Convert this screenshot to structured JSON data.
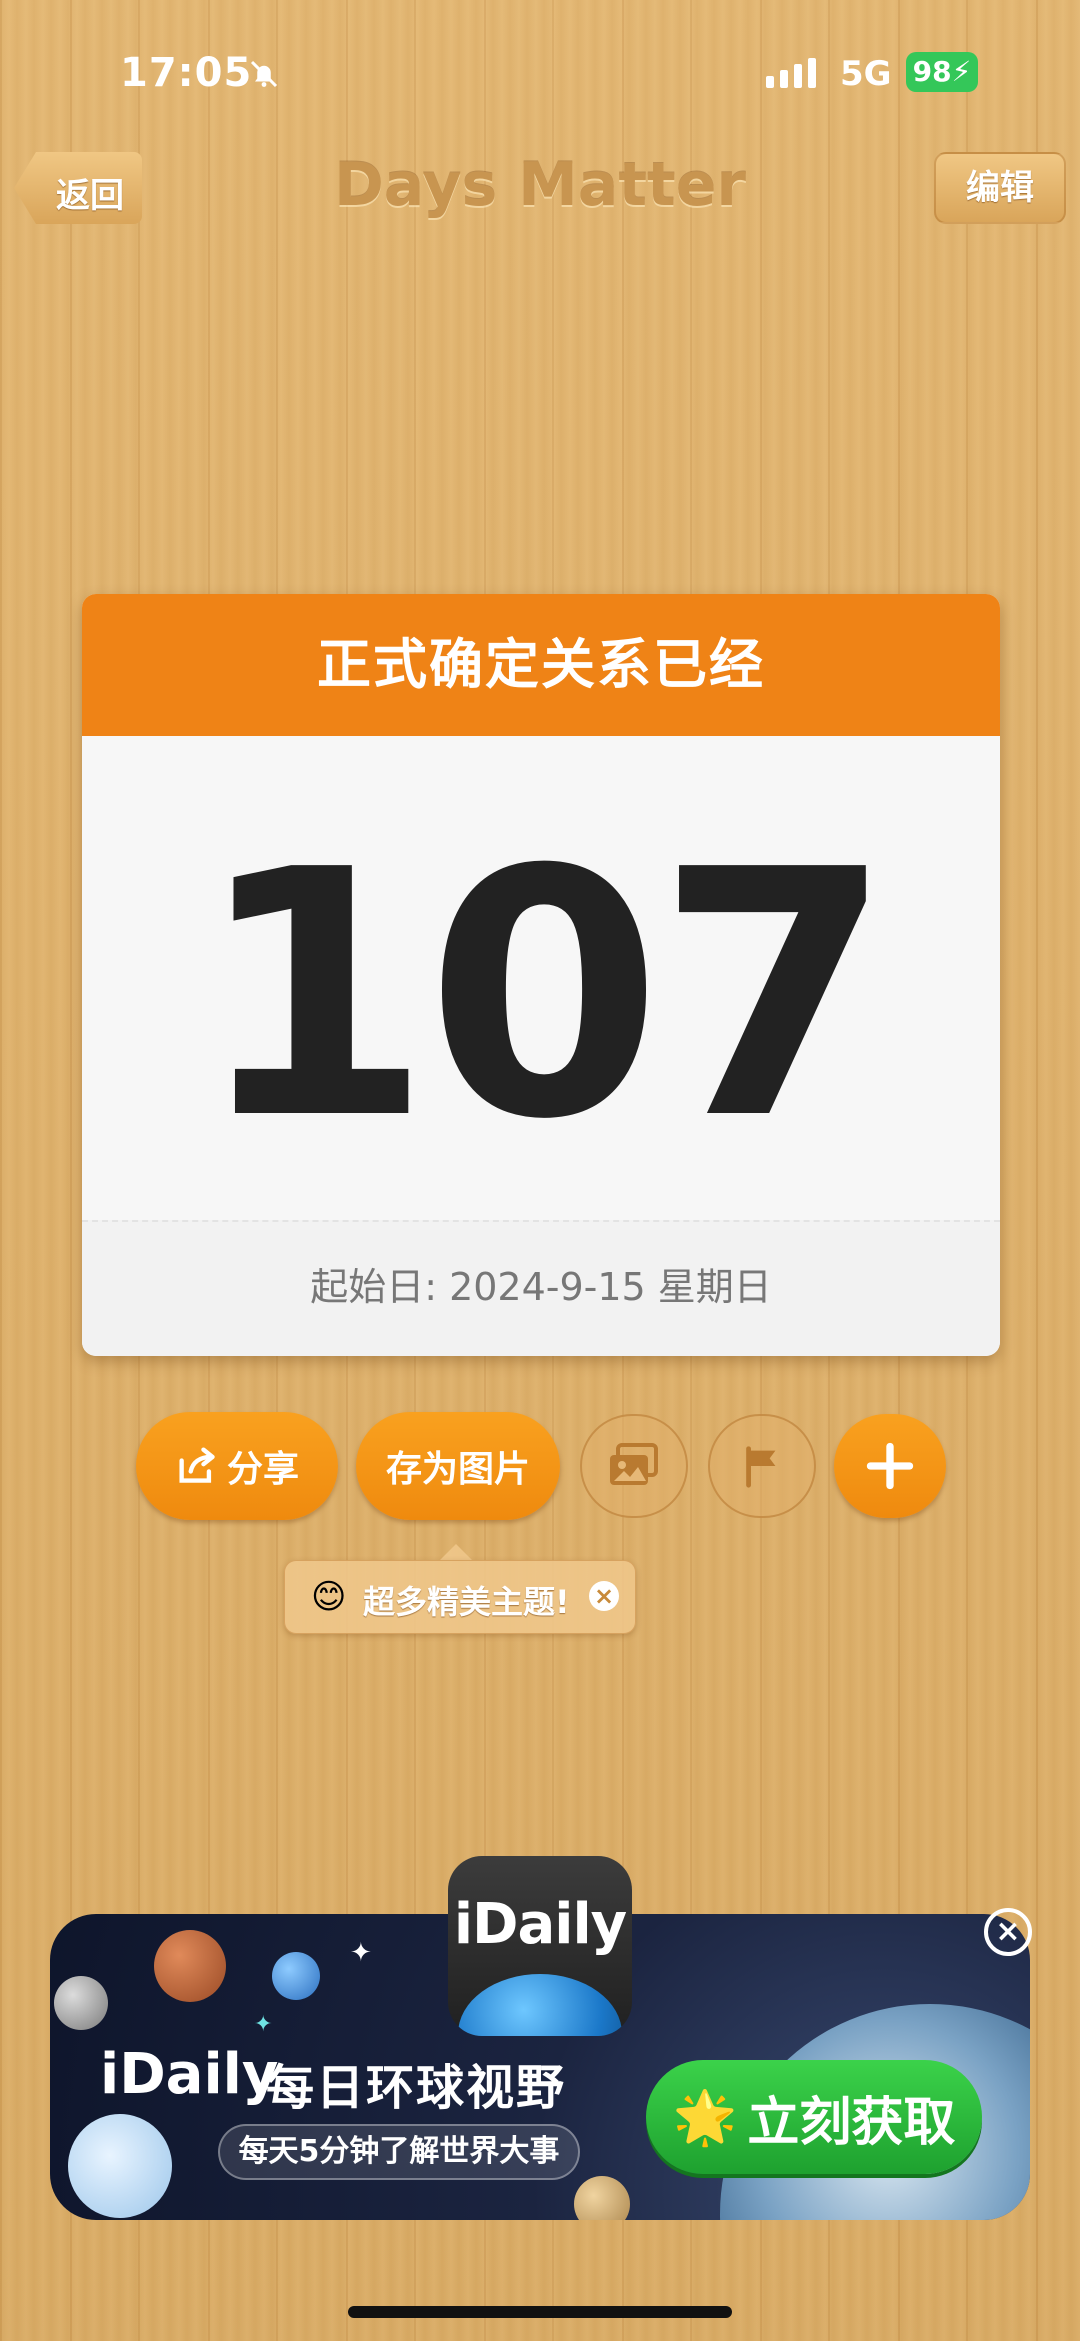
{
  "status_bar": {
    "time": "17:05",
    "network": "5G",
    "battery": "98"
  },
  "nav": {
    "back_label": "返回",
    "title": "Days Matter",
    "edit_label": "编辑"
  },
  "card": {
    "title": "正式确定关系已经",
    "days": "107",
    "start_date": "起始日: 2024-9-15 星期日"
  },
  "actions": {
    "share_label": "分享",
    "save_image_label": "存为图片",
    "theme_icon": "image-icon",
    "flag_icon": "flag-icon",
    "add_icon": "plus-icon"
  },
  "tooltip": {
    "emoji": "😊",
    "text": "超多精美主题!"
  },
  "ad": {
    "logo_text": "iDaily",
    "brand": "iDaily",
    "headline": "每日环球视野",
    "subline": "每天5分钟了解世界大事",
    "cta": "立刻获取",
    "cta_emoji": "🌟"
  },
  "colors": {
    "accent": "#ef8316",
    "cta_green": "#2bbf3c",
    "battery_green": "#34c759"
  }
}
